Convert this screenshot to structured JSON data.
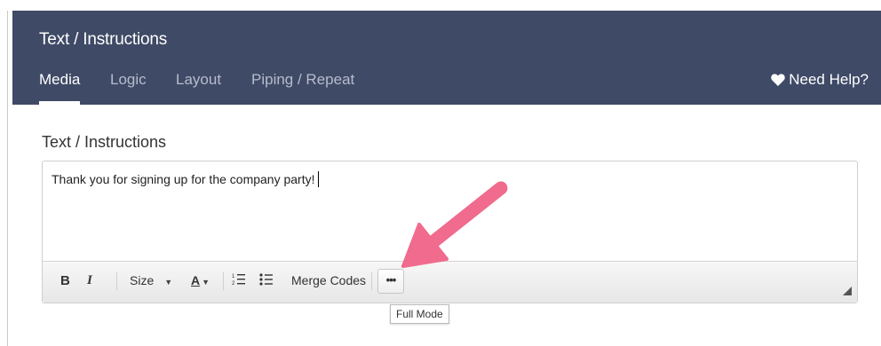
{
  "header": {
    "title": "Text / Instructions",
    "tabs": [
      {
        "label": "Media",
        "active": true
      },
      {
        "label": "Logic",
        "active": false
      },
      {
        "label": "Layout",
        "active": false
      },
      {
        "label": "Piping / Repeat",
        "active": false
      }
    ],
    "help_label": "Need Help?",
    "help_icon": "heart-icon"
  },
  "editor": {
    "label": "Text / Instructions",
    "content": "Thank you for signing up for the company party!",
    "toolbar": {
      "bold": "B",
      "italic": "I",
      "size_label": "Size",
      "font_color": "A",
      "merge_codes_label": "Merge Codes",
      "more_label": "•••"
    },
    "tooltip": "Full Mode"
  },
  "colors": {
    "header_bg": "#3f4a66",
    "arrow": "#f06b8d"
  }
}
